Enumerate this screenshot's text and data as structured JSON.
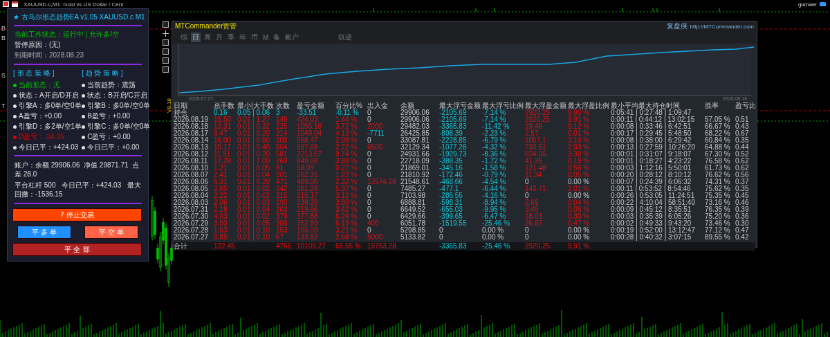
{
  "window": {
    "title": "XAUUSD.c,M1: Gold vs US Dollar / Cent",
    "user": "gumaer"
  },
  "chart_markers": [
    "B",
    "B",
    "S",
    "T"
  ],
  "axis_label": "V8.18",
  "ea_panel": {
    "title": "★ 古马尔形态趋势EA v1.05  XAUUSD.c  M1",
    "status_lines": [
      {
        "text": "当前工作状态：运行中 | 允许多/空",
        "kind": "ok"
      },
      {
        "text": "暂停原因：(无)",
        "kind": "normal"
      },
      {
        "text": "到期时间：2028.08.23",
        "kind": "muted"
      }
    ],
    "strategies": [
      {
        "heading": "[ 形 态 策 略 ]",
        "items": [
          {
            "text": "当前形态：无",
            "color": "#00c800"
          },
          {
            "text": "状态：A开启/D开启",
            "color": "#e0e0e0"
          },
          {
            "text": "引擎A：多0单/空0单",
            "color": "#e0e0e0"
          },
          {
            "text": "A盈亏：+0.00",
            "color": "#e0e0e0"
          },
          {
            "text": "引擎D：多2单/空1单",
            "color": "#e0e0e0"
          },
          {
            "text": "D盈亏：-34.35",
            "color": "#e00000"
          },
          {
            "text": "今日已平：+424.03",
            "color": "#e0e0e0"
          }
        ]
      },
      {
        "heading": "[ 趋 势 策 略 ]",
        "items": [
          {
            "text": "当前趋势：震荡",
            "color": "#e0e0e0"
          },
          {
            "text": "状态：B开启/C开启",
            "color": "#e0e0e0"
          },
          {
            "text": "引擎B：多0单/空0单",
            "color": "#e0e0e0"
          },
          {
            "text": "B盈亏：+0.00",
            "color": "#e0e0e0"
          },
          {
            "text": "引擎C：多0单/空0单",
            "color": "#e0e0e0"
          },
          {
            "text": "C盈亏：+0.00",
            "color": "#e0e0e0"
          },
          {
            "text": "今日已平：+0.00",
            "color": "#e0e0e0"
          }
        ]
      }
    ],
    "account_lines": [
      "账户：余额 29906.06  净值 29871.71  点差 28.0",
      "平台杠杆 500   今日已平：+424.03   最大回撤：-1536.15"
    ],
    "buttons": [
      {
        "label": "? 停止交易",
        "kind": "wide",
        "color": "#ff4500"
      },
      {
        "label": "平 多 单",
        "kind": "half",
        "color": "#1e90ff"
      },
      {
        "label": "平 空 单",
        "kind": "half",
        "color": "#ff6347"
      },
      {
        "label": "平 全 部",
        "kind": "wide",
        "color": "#b22222"
      }
    ]
  },
  "mtc_panel": {
    "title": "MTCommander资管",
    "brand": "复盘侠",
    "url": "http://MTCommander.com",
    "tabs": [
      {
        "label": "综",
        "selected": false
      },
      {
        "label": "日",
        "selected": true
      },
      {
        "label": "周",
        "selected": false
      },
      {
        "label": "月",
        "selected": false
      },
      {
        "label": "季",
        "selected": false
      },
      {
        "label": "年",
        "selected": false
      },
      {
        "label": "币",
        "selected": false
      },
      {
        "label": "M",
        "selected": false
      },
      {
        "label": "备",
        "selected": false
      },
      {
        "label": "账户",
        "selected": false
      },
      {
        "label": "轨迹",
        "selected": false
      }
    ],
    "chart_start": "2026.07.27",
    "chart_end": "2026.08.19",
    "table": {
      "columns": [
        "日期",
        "总手数",
        "最小|大手数",
        "次数",
        "盈亏金额",
        "百分比%",
        "出入金",
        "余额",
        "最大浮亏金额",
        "最大浮亏比例",
        "最大浮盈金额",
        "最大浮盈比例",
        "最小平均最大持仓时间",
        "胜率",
        "盈亏比"
      ],
      "rows": [
        [
          {
            "text": "持仓",
            "kind": "plain"
          },
          {
            "text": "0.16",
            "kind": "loss"
          },
          {
            "text": "0.05 | 0.06",
            "kind": "loss"
          },
          {
            "text": "3",
            "kind": "loss"
          },
          {
            "text": "-33.51",
            "kind": "loss"
          },
          {
            "text": "-0.11 %",
            "kind": "loss"
          },
          {
            "text": "0",
            "kind": "plain"
          },
          {
            "text": "29906.06",
            "kind": "plain"
          },
          {
            "text": "-2105.69",
            "kind": "loss"
          },
          {
            "text": "-7.14 %",
            "kind": "loss"
          },
          {
            "text": "2920.25",
            "kind": "gain"
          },
          {
            "text": "9.90 %",
            "kind": "gain"
          },
          {
            "text": "0:05:41 | 0:27:48 | 1:09:47",
            "kind": "plain"
          }
        ],
        [
          {
            "text": "2026.08.19",
            "kind": "plain"
          },
          {
            "text": "15.50",
            "kind": "gain"
          },
          {
            "text": "0.01 | 1.27",
            "kind": "gain"
          },
          {
            "text": "149",
            "kind": "gain"
          },
          {
            "text": "424.03",
            "kind": "gain"
          },
          {
            "text": "1.44 %",
            "kind": "gain"
          },
          {
            "text": "0",
            "kind": "plain"
          },
          {
            "text": "29906.06",
            "kind": "plain"
          },
          {
            "text": "-2105.69",
            "kind": "loss"
          },
          {
            "text": "-7.14 %",
            "kind": "loss"
          },
          {
            "text": "2920.25",
            "kind": "gain"
          },
          {
            "text": "9.91 %",
            "kind": "gain"
          },
          {
            "text": "0:00:11 | 0:44:12 | 13:02:15",
            "kind": "plain"
          },
          {
            "text": "57.05 %",
            "kind": "plain"
          },
          {
            "text": "0.51",
            "kind": "plain"
          }
        ],
        [
          {
            "text": "2026.08.18",
            "kind": "plain"
          },
          {
            "text": "13.31",
            "kind": "gain"
          },
          {
            "text": "0.01 | 0.32",
            "kind": "gain"
          },
          {
            "text": "225",
            "kind": "gain"
          },
          {
            "text": "1056.18",
            "kind": "gain"
          },
          {
            "text": "3.72 %",
            "kind": "gain"
          },
          {
            "text": "2000",
            "kind": "gain"
          },
          {
            "text": "29482.03",
            "kind": "plain"
          },
          {
            "text": "-3365.83",
            "kind": "loss"
          },
          {
            "text": "-11.42 %",
            "kind": "loss"
          },
          {
            "text": "19.46",
            "kind": "gain"
          },
          {
            "text": "0.12 %",
            "kind": "gain"
          },
          {
            "text": "0:00:08 | 0:33:46 | 6:42:51",
            "kind": "plain"
          },
          {
            "text": "66.67 %",
            "kind": "plain"
          },
          {
            "text": "0.43",
            "kind": "plain"
          }
        ],
        [
          {
            "text": "2026.08.17",
            "kind": "plain"
          },
          {
            "text": "9.47",
            "kind": "gain"
          },
          {
            "text": "0.01 | 0.20",
            "kind": "gain"
          },
          {
            "text": "214",
            "kind": "gain"
          },
          {
            "text": "1049.04",
            "kind": "gain"
          },
          {
            "text": "4.13 %",
            "kind": "gain"
          },
          {
            "text": "-7711",
            "kind": "loss"
          },
          {
            "text": "26425.85",
            "kind": "plain"
          },
          {
            "text": "-898.39",
            "kind": "loss"
          },
          {
            "text": "-2.23 %",
            "kind": "loss"
          },
          {
            "text": "2.57",
            "kind": "gain"
          },
          {
            "text": "0.01 %",
            "kind": "gain"
          },
          {
            "text": "0:00:17 | 0:29:45 | 5:48:50",
            "kind": "plain"
          },
          {
            "text": "68.22 %",
            "kind": "plain"
          },
          {
            "text": "0.67",
            "kind": "plain"
          }
        ],
        [
          {
            "text": "2026.08.14",
            "kind": "plain"
          },
          {
            "text": "16.00",
            "kind": "gain"
          },
          {
            "text": "0.01 | 0.50",
            "kind": "gain"
          },
          {
            "text": "309",
            "kind": "gain"
          },
          {
            "text": "958.47",
            "kind": "gain"
          },
          {
            "text": "2.98 %",
            "kind": "gain"
          },
          {
            "text": "0",
            "kind": "plain"
          },
          {
            "text": "33087.81",
            "kind": "plain"
          },
          {
            "text": "-2228.85",
            "kind": "loss"
          },
          {
            "text": "-6.79 %",
            "kind": "loss"
          },
          {
            "text": "1057.1",
            "kind": "gain"
          },
          {
            "text": "3.19 %",
            "kind": "gain"
          },
          {
            "text": "0:00:08 | 0:38:00 | 6:29:42",
            "kind": "plain"
          },
          {
            "text": "60.84 %",
            "kind": "plain"
          },
          {
            "text": "0.35",
            "kind": "plain"
          }
        ],
        [
          {
            "text": "2026.08.13",
            "kind": "plain"
          },
          {
            "text": "10.17",
            "kind": "gain"
          },
          {
            "text": "0.01 | 0.40",
            "kind": "gain"
          },
          {
            "text": "504",
            "kind": "gain"
          },
          {
            "text": "697.68",
            "kind": "gain"
          },
          {
            "text": "2.22 %",
            "kind": "gain"
          },
          {
            "text": "6500",
            "kind": "gain"
          },
          {
            "text": "32129.34",
            "kind": "plain"
          },
          {
            "text": "-1077.28",
            "kind": "loss"
          },
          {
            "text": "-4.32 %",
            "kind": "loss"
          },
          {
            "text": "730.51",
            "kind": "gain"
          },
          {
            "text": "2.93 %",
            "kind": "gain"
          },
          {
            "text": "0:00:13 | 0:27:59 | 10:26:20",
            "kind": "plain"
          },
          {
            "text": "64.88 %",
            "kind": "plain"
          },
          {
            "text": "0.44",
            "kind": "plain"
          }
        ],
        [
          {
            "text": "2026.08.12",
            "kind": "plain"
          },
          {
            "text": "11.51",
            "kind": "gain"
          },
          {
            "text": "0.01 | 0.20",
            "kind": "gain"
          },
          {
            "text": "581",
            "kind": "gain"
          },
          {
            "text": "2213.57",
            "kind": "gain"
          },
          {
            "text": "9.74 %",
            "kind": "gain"
          },
          {
            "text": "0",
            "kind": "plain"
          },
          {
            "text": "24931.66",
            "kind": "plain"
          },
          {
            "text": "-1929.73",
            "kind": "loss"
          },
          {
            "text": "-8.36 %",
            "kind": "loss"
          },
          {
            "text": "824.06",
            "kind": "gain"
          },
          {
            "text": "3.38 %",
            "kind": "gain"
          },
          {
            "text": "0:00:01 | 0:31:07 | 9:18:07",
            "kind": "plain"
          },
          {
            "text": "67.30 %",
            "kind": "plain"
          },
          {
            "text": "0.52",
            "kind": "plain"
          }
        ],
        [
          {
            "text": "2026.08.11",
            "kind": "plain"
          },
          {
            "text": "17.28",
            "kind": "gain"
          },
          {
            "text": "0.01 | 7.00",
            "kind": "gain"
          },
          {
            "text": "269",
            "kind": "gain"
          },
          {
            "text": "849.08",
            "kind": "gain"
          },
          {
            "text": "3.88 %",
            "kind": "gain"
          },
          {
            "text": "0",
            "kind": "plain"
          },
          {
            "text": "22718.09",
            "kind": "plain"
          },
          {
            "text": "-388.35",
            "kind": "loss"
          },
          {
            "text": "-1.72 %",
            "kind": "loss"
          },
          {
            "text": "41.35",
            "kind": "gain"
          },
          {
            "text": "0.19 %",
            "kind": "gain"
          },
          {
            "text": "0:00:01 | 0:18:27 | 4:23:22",
            "kind": "plain"
          },
          {
            "text": "76.58 %",
            "kind": "plain"
          },
          {
            "text": "0.62",
            "kind": "plain"
          }
        ],
        [
          {
            "text": "2026.08.10",
            "kind": "plain"
          },
          {
            "text": "1.21",
            "kind": "gain"
          },
          {
            "text": "0.01 | 0.05",
            "kind": "gain"
          },
          {
            "text": "81",
            "kind": "gain"
          },
          {
            "text": "58.09",
            "kind": "gain"
          },
          {
            "text": "0.27 %",
            "kind": "gain"
          },
          {
            "text": "0",
            "kind": "plain"
          },
          {
            "text": "21869.01",
            "kind": "plain"
          },
          {
            "text": "-345.16",
            "kind": "loss"
          },
          {
            "text": "-1.58 %",
            "kind": "loss"
          },
          {
            "text": "121.48",
            "kind": "gain"
          },
          {
            "text": "0.56 %",
            "kind": "gain"
          },
          {
            "text": "0:00:03 | 1:12:16 | 5:50:01",
            "kind": "plain"
          },
          {
            "text": "61.73 %",
            "kind": "plain"
          },
          {
            "text": "0.62",
            "kind": "plain"
          }
        ],
        [
          {
            "text": "2026.08.07",
            "kind": "plain"
          },
          {
            "text": "2.41",
            "kind": "gain"
          },
          {
            "text": "0.01 | 0.04",
            "kind": "gain"
          },
          {
            "text": "201",
            "kind": "gain"
          },
          {
            "text": "262.31",
            "kind": "gain"
          },
          {
            "text": "1.22 %",
            "kind": "gain"
          },
          {
            "text": "0",
            "kind": "plain"
          },
          {
            "text": "21810.92",
            "kind": "plain"
          },
          {
            "text": "-172.46",
            "kind": "loss"
          },
          {
            "text": "-0.79 %",
            "kind": "loss"
          },
          {
            "text": "11.34",
            "kind": "gain"
          },
          {
            "text": "0.05 %",
            "kind": "gain"
          },
          {
            "text": "0:00:20 | 0:28:12 | 8:10:12",
            "kind": "plain"
          },
          {
            "text": "76.62 %",
            "kind": "plain"
          },
          {
            "text": "0.56",
            "kind": "plain"
          }
        ],
        [
          {
            "text": "2026.08.06",
            "kind": "plain"
          },
          {
            "text": "6.31",
            "kind": "gain"
          },
          {
            "text": "0.01 | 0.20",
            "kind": "gain"
          },
          {
            "text": "471",
            "kind": "gain"
          },
          {
            "text": "489.06",
            "kind": "gain"
          },
          {
            "text": "2.32 %",
            "kind": "gain"
          },
          {
            "text": "13574.28",
            "kind": "gain"
          },
          {
            "text": "21548.61",
            "kind": "plain"
          },
          {
            "text": "-468.66",
            "kind": "loss"
          },
          {
            "text": "-4.54 %",
            "kind": "loss"
          },
          {
            "text": "0",
            "kind": "plain"
          },
          {
            "text": "0.00 %",
            "kind": "plain"
          },
          {
            "text": "0:00:07 | 0:24:39 | 6:06:32",
            "kind": "plain"
          },
          {
            "text": "74.31 %",
            "kind": "plain"
          },
          {
            "text": "0.37",
            "kind": "plain"
          }
        ],
        [
          {
            "text": "2026.08.05",
            "kind": "plain"
          },
          {
            "text": "2.65",
            "kind": "gain"
          },
          {
            "text": "0.01 | 0.02",
            "kind": "gain"
          },
          {
            "text": "242",
            "kind": "gain"
          },
          {
            "text": "381.29",
            "kind": "gain"
          },
          {
            "text": "5.37 %",
            "kind": "gain"
          },
          {
            "text": "0",
            "kind": "plain"
          },
          {
            "text": "7485.27",
            "kind": "plain"
          },
          {
            "text": "-477.1",
            "kind": "loss"
          },
          {
            "text": "-6.44 %",
            "kind": "loss"
          },
          {
            "text": "142.71",
            "kind": "gain"
          },
          {
            "text": "2.01 %",
            "kind": "gain"
          },
          {
            "text": "0:00:11 | 0:53:52 | 8:54:46",
            "kind": "plain"
          },
          {
            "text": "75.62 %",
            "kind": "plain"
          },
          {
            "text": "0.35",
            "kind": "plain"
          }
        ],
        [
          {
            "text": "2026.08.04",
            "kind": "plain"
          },
          {
            "text": "2.22",
            "kind": "gain"
          },
          {
            "text": "0.01 | 0.02",
            "kind": "gain"
          },
          {
            "text": "215",
            "kind": "gain"
          },
          {
            "text": "215.17",
            "kind": "gain"
          },
          {
            "text": "3.12 %",
            "kind": "gain"
          },
          {
            "text": "0",
            "kind": "plain"
          },
          {
            "text": "7103.98",
            "kind": "plain"
          },
          {
            "text": "-286.55",
            "kind": "loss"
          },
          {
            "text": "-4.16 %",
            "kind": "loss"
          },
          {
            "text": "0",
            "kind": "plain"
          },
          {
            "text": "0.00 %",
            "kind": "plain"
          },
          {
            "text": "0:00:26 | 0:53:05 | 11:24:51",
            "kind": "plain"
          },
          {
            "text": "75.35 %",
            "kind": "plain"
          },
          {
            "text": "0.45",
            "kind": "plain"
          }
        ],
        [
          {
            "text": "2026.08.03",
            "kind": "plain"
          },
          {
            "text": "2.06",
            "kind": "gain"
          },
          {
            "text": "0.01 | 0.03",
            "kind": "gain"
          },
          {
            "text": "190",
            "kind": "gain"
          },
          {
            "text": "239.29",
            "kind": "gain"
          },
          {
            "text": "3.60 %",
            "kind": "gain"
          },
          {
            "text": "0",
            "kind": "plain"
          },
          {
            "text": "6888.81",
            "kind": "plain"
          },
          {
            "text": "-598.31",
            "kind": "loss"
          },
          {
            "text": "-8.94 %",
            "kind": "loss"
          },
          {
            "text": "2.69",
            "kind": "gain"
          },
          {
            "text": "0.04 %",
            "kind": "gain"
          },
          {
            "text": "0:00:22 | 4:10:04 | 58:51:40",
            "kind": "plain"
          },
          {
            "text": "73.16 %",
            "kind": "plain"
          },
          {
            "text": "0.46",
            "kind": "plain"
          }
        ],
        [
          {
            "text": "2026.07.31",
            "kind": "plain"
          },
          {
            "text": "2.18",
            "kind": "gain"
          },
          {
            "text": "0.01 | 0.04",
            "kind": "gain"
          },
          {
            "text": "203",
            "kind": "gain"
          },
          {
            "text": "219.66",
            "kind": "gain"
          },
          {
            "text": "3.42 %",
            "kind": "gain"
          },
          {
            "text": "0",
            "kind": "plain"
          },
          {
            "text": "6649.52",
            "kind": "plain"
          },
          {
            "text": "-655.03",
            "kind": "loss"
          },
          {
            "text": "-9.95 %",
            "kind": "loss"
          },
          {
            "text": "3.45",
            "kind": "gain"
          },
          {
            "text": "0.05 %",
            "kind": "gain"
          },
          {
            "text": "0:00:09 | 0:45:12 | 8:35:51",
            "kind": "plain"
          },
          {
            "text": "76.35 %",
            "kind": "plain"
          },
          {
            "text": "0.39",
            "kind": "plain"
          }
        ],
        [
          {
            "text": "2026.07.30",
            "kind": "plain"
          },
          {
            "text": "4.03",
            "kind": "gain"
          },
          {
            "text": "0.01 | 0.02",
            "kind": "gain"
          },
          {
            "text": "379",
            "kind": "gain"
          },
          {
            "text": "377.88",
            "kind": "gain"
          },
          {
            "text": "6.24 %",
            "kind": "gain"
          },
          {
            "text": "0",
            "kind": "plain"
          },
          {
            "text": "6429.66",
            "kind": "plain"
          },
          {
            "text": "-399.65",
            "kind": "loss"
          },
          {
            "text": "-6.47 %",
            "kind": "loss"
          },
          {
            "text": "18.03",
            "kind": "gain"
          },
          {
            "text": "0.30 %",
            "kind": "gain"
          },
          {
            "text": "0:00:03 | 0:35:39 | 6:05:26",
            "kind": "plain"
          },
          {
            "text": "75.20 %",
            "kind": "plain"
          },
          {
            "text": "0.36",
            "kind": "plain"
          }
        ],
        [
          {
            "text": "2026.07.29",
            "kind": "plain"
          },
          {
            "text": "3.50",
            "kind": "gain"
          },
          {
            "text": "0.01 | 0.05",
            "kind": "gain"
          },
          {
            "text": "309",
            "kind": "gain"
          },
          {
            "text": "352.93",
            "kind": "gain"
          },
          {
            "text": "6.19 %",
            "kind": "gain"
          },
          {
            "text": "400",
            "kind": "gain"
          },
          {
            "text": "6051.78",
            "kind": "plain"
          },
          {
            "text": "-1519.55",
            "kind": "loss"
          },
          {
            "text": "-25.46 %",
            "kind": "loss"
          },
          {
            "text": "26.87",
            "kind": "gain"
          },
          {
            "text": "0.47 %",
            "kind": "gain"
          },
          {
            "text": "0:00:02 | 0:49:33 | 9:43:20",
            "kind": "plain"
          },
          {
            "text": "73.46 %",
            "kind": "plain"
          },
          {
            "text": "0.30",
            "kind": "plain"
          }
        ],
        [
          {
            "text": "2026.07.28",
            "kind": "plain"
          },
          {
            "text": "1.63",
            "kind": "gain"
          },
          {
            "text": "0.01 | 0.10",
            "kind": "gain"
          },
          {
            "text": "153",
            "kind": "gain"
          },
          {
            "text": "165.03",
            "kind": "gain"
          },
          {
            "text": "3.21 %",
            "kind": "gain"
          },
          {
            "text": "0",
            "kind": "plain"
          },
          {
            "text": "5298.85",
            "kind": "plain"
          },
          {
            "text": "0",
            "kind": "plain"
          },
          {
            "text": "0.00 %",
            "kind": "plain"
          },
          {
            "text": "0",
            "kind": "plain"
          },
          {
            "text": "0.00 %",
            "kind": "plain"
          },
          {
            "text": "0:00:19 | 0:52:00 | 13:12:47",
            "kind": "plain"
          },
          {
            "text": "77.12 %",
            "kind": "plain"
          },
          {
            "text": "0.47",
            "kind": "plain"
          }
        ],
        [
          {
            "text": "2026.07.27",
            "kind": "plain"
          },
          {
            "text": "0.85",
            "kind": "gain"
          },
          {
            "text": "0.01 | 0.10",
            "kind": "gain"
          },
          {
            "text": "67",
            "kind": "gain"
          },
          {
            "text": "133.82",
            "kind": "gain"
          },
          {
            "text": "2.68 %",
            "kind": "gain"
          },
          {
            "text": "5000",
            "kind": "gain"
          },
          {
            "text": "5133.82",
            "kind": "plain"
          },
          {
            "text": "0",
            "kind": "plain"
          },
          {
            "text": "0.00 %",
            "kind": "plain"
          },
          {
            "text": "0",
            "kind": "plain"
          },
          {
            "text": "0.00 %",
            "kind": "plain"
          },
          {
            "text": "0:00:28 | 0:40:32 | 3:07:15",
            "kind": "plain"
          },
          {
            "text": "89.55 %",
            "kind": "plain"
          },
          {
            "text": "0.42",
            "kind": "plain"
          }
        ]
      ],
      "total": [
        {
          "text": "合计",
          "kind": "plain"
        },
        {
          "text": "122.45",
          "kind": "gain"
        },
        {
          "kind": "blank"
        },
        {
          "text": "4765",
          "kind": "gain"
        },
        {
          "text": "10109.27",
          "kind": "gain"
        },
        {
          "text": "65.65 %",
          "kind": "gain"
        },
        {
          "text": "19763.28",
          "kind": "gain"
        },
        {
          "kind": "blank"
        },
        {
          "text": "-3365.83",
          "kind": "loss"
        },
        {
          "text": "-25.46 %",
          "kind": "loss"
        },
        {
          "text": "2920.25",
          "kind": "gain"
        },
        {
          "text": "9.91 %",
          "kind": "gain"
        }
      ]
    }
  }
}
